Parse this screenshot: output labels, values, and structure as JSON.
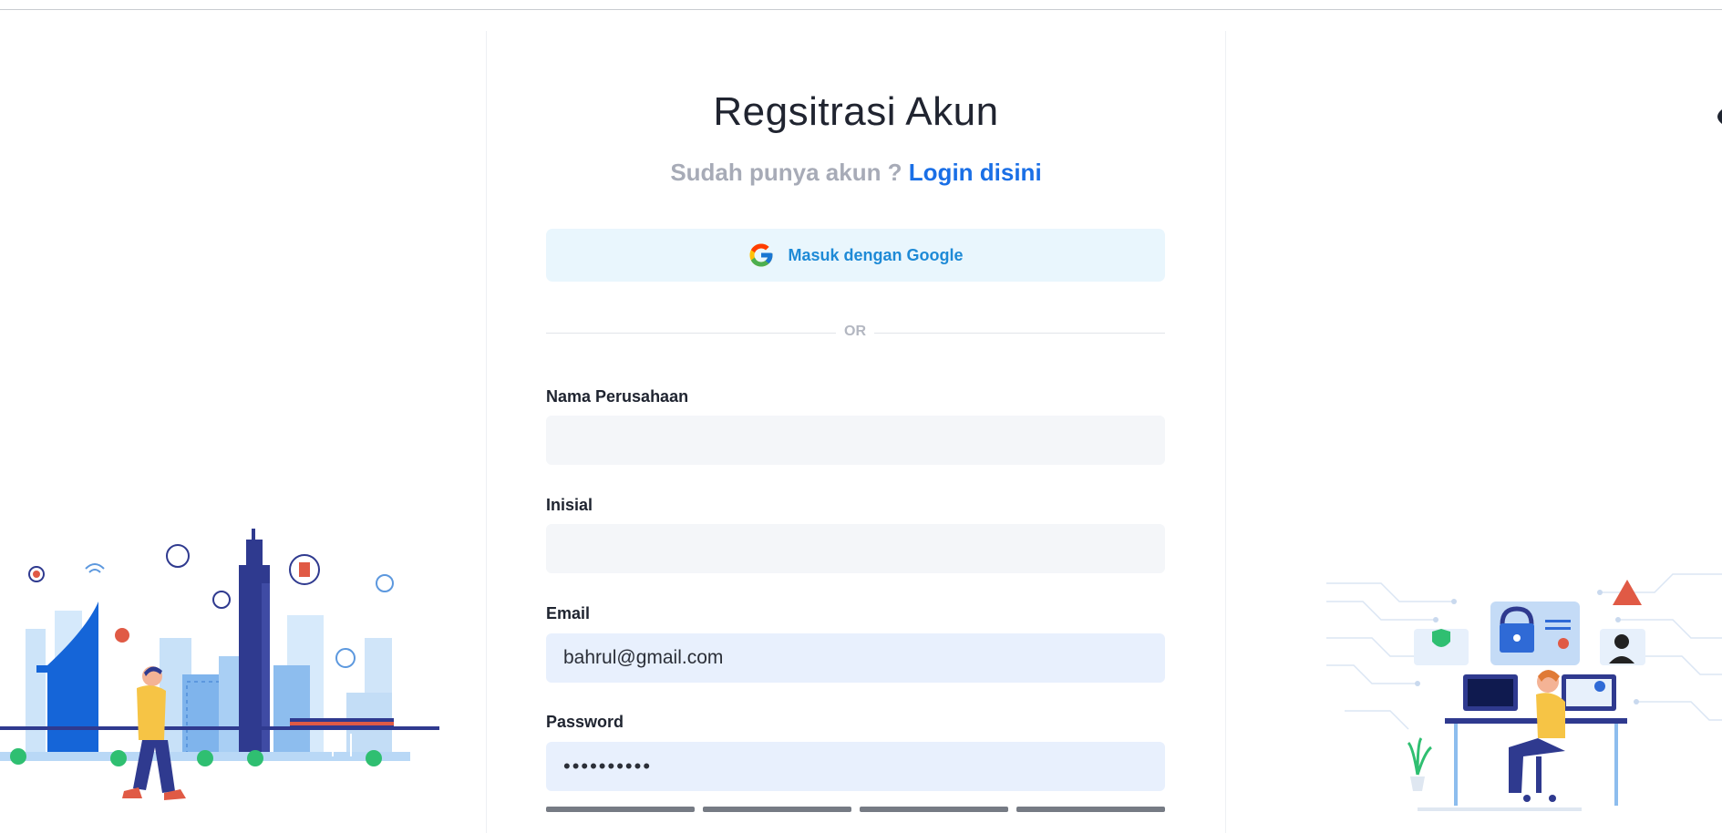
{
  "page": {
    "title": "Regsitrasi Akun",
    "subtitle_prefix": "Sudah punya akun ?",
    "login_link": "Login disini"
  },
  "google_button": {
    "label": "Masuk dengan Google",
    "icon": "google-icon"
  },
  "divider_text": "OR",
  "form": {
    "company_label": "Nama Perusahaan",
    "company_value": "",
    "initial_label": "Inisial",
    "initial_value": "",
    "email_label": "Email",
    "email_value": "bahrul@gmail.com",
    "password_label": "Password",
    "password_value": "••••••••••"
  },
  "colors": {
    "link": "#1a6fe6",
    "google_button_bg": "#e9f6fd",
    "google_button_text": "#1e8ad6",
    "filled_input_bg": "#e8f0fd",
    "empty_input_bg": "#f4f6f9",
    "strength_bar": "#767b84"
  },
  "illustrations": [
    "city-illustration",
    "cybersecurity-illustration"
  ]
}
